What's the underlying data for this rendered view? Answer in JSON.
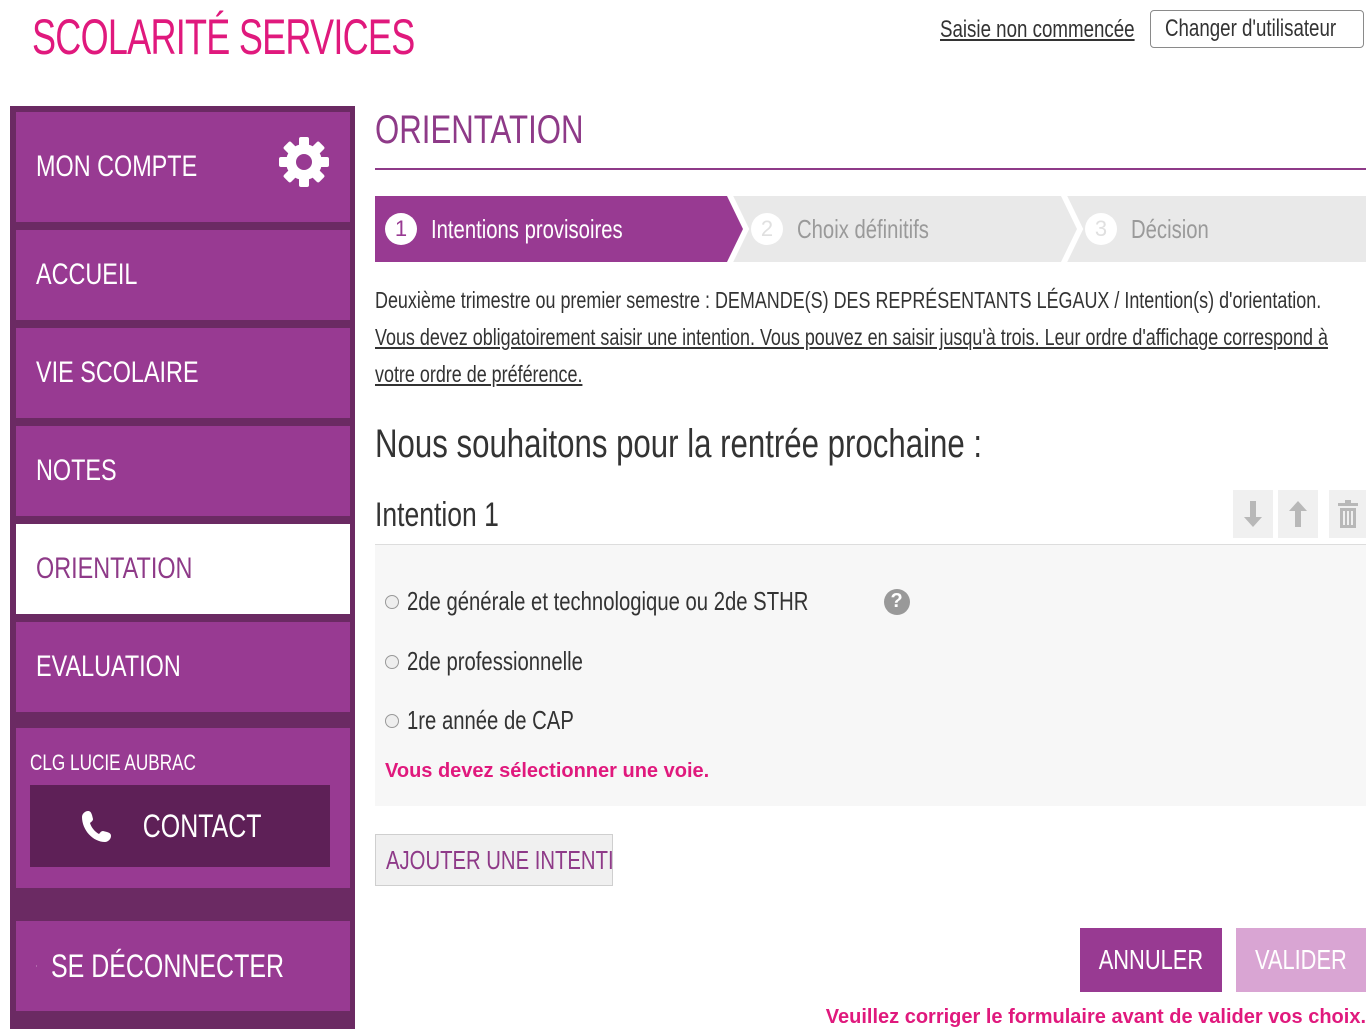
{
  "header": {
    "logo": "SCOLARITÉ SERVICES",
    "status_link": "Saisie non commencée",
    "change_user": "Changer d'utilisateur"
  },
  "sidebar": {
    "items": [
      {
        "label": "MON COMPTE",
        "icon": "gear-icon"
      },
      {
        "label": "ACCUEIL"
      },
      {
        "label": "VIE SCOLAIRE"
      },
      {
        "label": "NOTES"
      },
      {
        "label": "ORIENTATION",
        "active": true
      },
      {
        "label": "EVALUATION"
      }
    ],
    "school_name": "CLG LUCIE AUBRAC",
    "contact_label": "CONTACT",
    "logout_label": "SE DÉCONNECTER"
  },
  "main": {
    "title": "ORIENTATION",
    "steps": [
      {
        "number": "1",
        "label": "Intentions provisoires",
        "state": "active"
      },
      {
        "number": "2",
        "label": "Choix définitifs",
        "state": "inactive"
      },
      {
        "number": "3",
        "label": "Décision",
        "state": "inactive"
      }
    ],
    "desc_line1": "Deuxième trimestre ou premier semestre : DEMANDE(S) DES REPRÉSENTANTS LÉGAUX / Intention(s) d'orientation.",
    "desc_line2": "Vous devez obligatoirement saisir une intention. Vous pouvez en saisir jusqu'à trois. Leur ordre d'affichage correspond à votre ordre de préférence.",
    "subtitle": "Nous souhaitons pour la rentrée prochaine :",
    "intention": {
      "title": "Intention 1",
      "options": [
        {
          "label": "2de générale et technologique ou 2de STHR",
          "help": true
        },
        {
          "label": "2de professionnelle"
        },
        {
          "label": "1re année de CAP"
        }
      ],
      "error": "Vous devez sélectionner une voie."
    },
    "add_button": "AJOUTER UNE INTENTION",
    "cancel_button": "ANNULER",
    "validate_button": "VALIDER",
    "form_error": "Veuillez corriger le formulaire avant de valider vos choix."
  },
  "colors": {
    "brand_pink": "#e0197d",
    "purple": "#983a92",
    "dark_purple": "#6b2a63",
    "title_purple": "#8e3a88"
  }
}
